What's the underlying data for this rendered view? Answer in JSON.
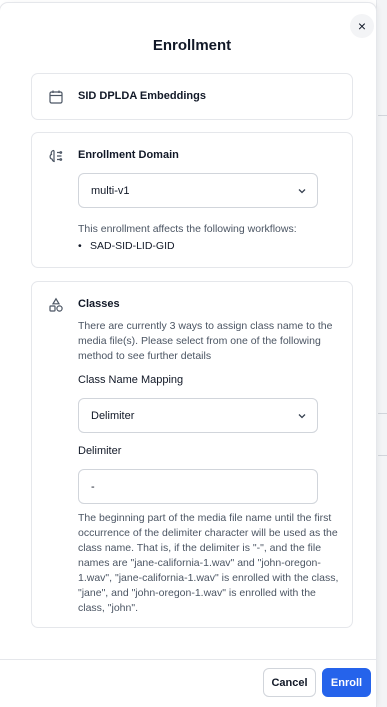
{
  "dialog": {
    "title": "Enrollment",
    "close_label": "×"
  },
  "plugin_card": {
    "title": "SID DPLDA Embeddings",
    "icon": "calendar-icon"
  },
  "domain_card": {
    "title": "Enrollment Domain",
    "icon": "brain-icon",
    "selected_domain": "multi-v1",
    "affects_text": "This enrollment affects the following workflows:",
    "workflows": [
      "SAD-SID-LID-GID"
    ]
  },
  "classes_card": {
    "title": "Classes",
    "icon": "shapes-icon",
    "description": "There are currently 3 ways to assign class name to the media file(s). Please select from one of the following method to see further details",
    "mapping_label": "Class Name Mapping",
    "mapping_selected": "Delimiter",
    "delimiter_label": "Delimiter",
    "delimiter_value": "-",
    "explanation": "The beginning part of the media file name until the first occurrence of the delimiter character will be used as the class name. That is, if the delimiter is \"-\", and the file names are \"jane-california-1.wav\" and \"john-oregon-1.wav\", \"jane-california-1.wav\" is enrolled with the class, \"jane\", and \"john-oregon-1.wav\" is enrolled with the class, \"john\"."
  },
  "footer": {
    "cancel_label": "Cancel",
    "enroll_label": "Enroll"
  },
  "colors": {
    "primary": "#2563eb",
    "border": "#e5e7eb",
    "text": "#111827",
    "muted": "#4b5563"
  }
}
